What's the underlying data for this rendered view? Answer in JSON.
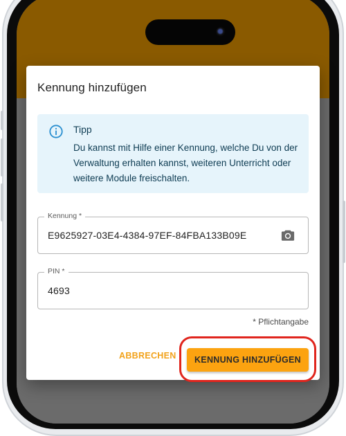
{
  "dialog": {
    "title": "Kennung hinzufügen"
  },
  "tip": {
    "icon": "info-icon",
    "title": "Tipp",
    "text": "Du kannst mit Hilfe einer Kennung, welche Du von der Verwaltung erhalten kannst, weiteren Unterricht oder weitere Module freischalten."
  },
  "fields": {
    "kennung": {
      "label": "Kennung *",
      "value": "E9625927-03E4-4384-97EF-84FBA133B09E",
      "icon": "camera-icon"
    },
    "pin": {
      "label": "PIN *",
      "value": "4693"
    }
  },
  "required_note": "* Pflichtangabe",
  "actions": {
    "cancel_label": "ABBRECHEN",
    "submit_label": "KENNUNG HINZUFÜGEN"
  },
  "colors": {
    "accent": "#fca310",
    "header": "#8a5a00",
    "tip_background": "#e6f4fb",
    "highlight": "#e0251d"
  }
}
